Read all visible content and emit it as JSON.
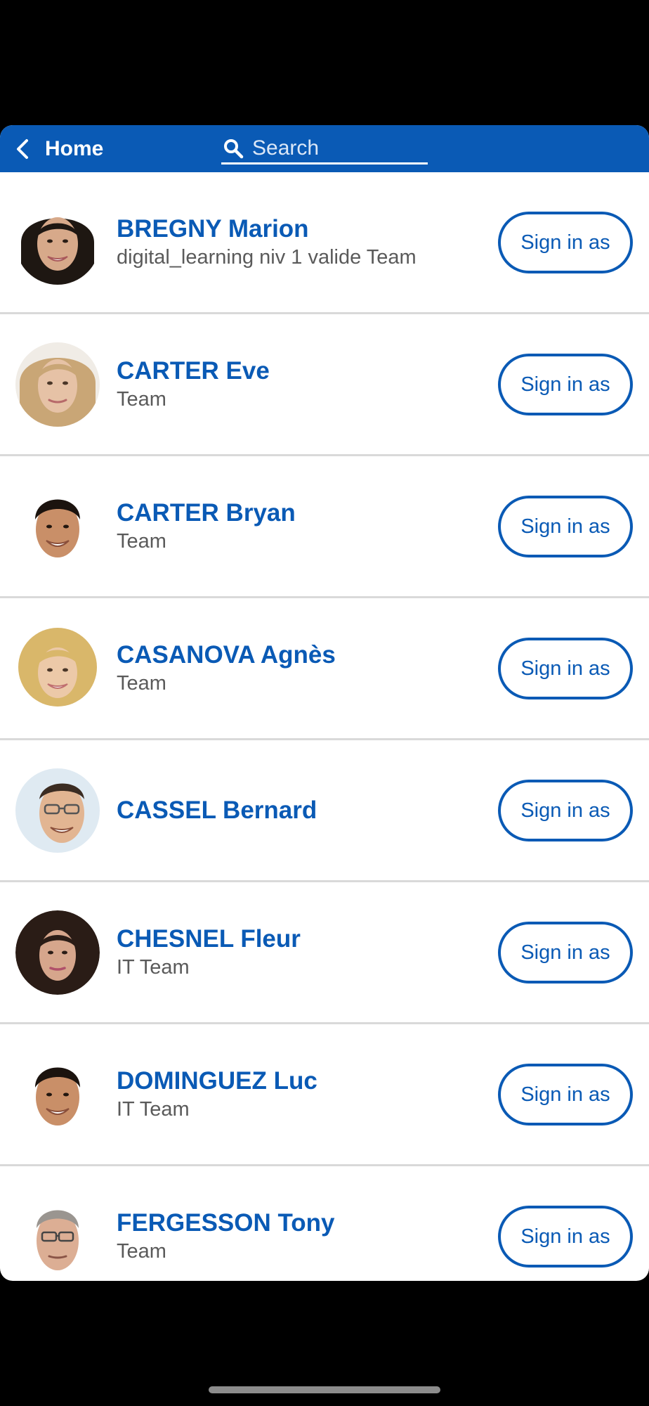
{
  "header": {
    "back_label": "Home",
    "search_placeholder": "Search",
    "search_value": "",
    "color": "#0a5ab5"
  },
  "users": [
    {
      "name": "BREGNY Marion",
      "team": "digital_learning niv 1 valide Team",
      "button_label": "Sign in as",
      "avatar": "avatar-woman-dark-hair"
    },
    {
      "name": "CARTER Eve",
      "team": "Team",
      "button_label": "Sign in as",
      "avatar": "avatar-woman-blonde"
    },
    {
      "name": "CARTER Bryan",
      "team": "Team",
      "button_label": "Sign in as",
      "avatar": "avatar-man-dark-hair"
    },
    {
      "name": "CASANOVA Agnès",
      "team": "Team",
      "button_label": "Sign in as",
      "avatar": "avatar-woman-curly-blonde"
    },
    {
      "name": "CASSEL Bernard",
      "team": "",
      "button_label": "Sign in as",
      "avatar": "avatar-man-glasses"
    },
    {
      "name": "CHESNEL Fleur",
      "team": "IT Team",
      "button_label": "Sign in as",
      "avatar": "avatar-woman-curly-dark"
    },
    {
      "name": "DOMINGUEZ Luc",
      "team": "IT Team",
      "button_label": "Sign in as",
      "avatar": "avatar-man-dark-hair"
    },
    {
      "name": "FERGESSON Tony",
      "team": "Team",
      "button_label": "Sign in as",
      "avatar": "avatar-man-gray-glasses"
    }
  ]
}
